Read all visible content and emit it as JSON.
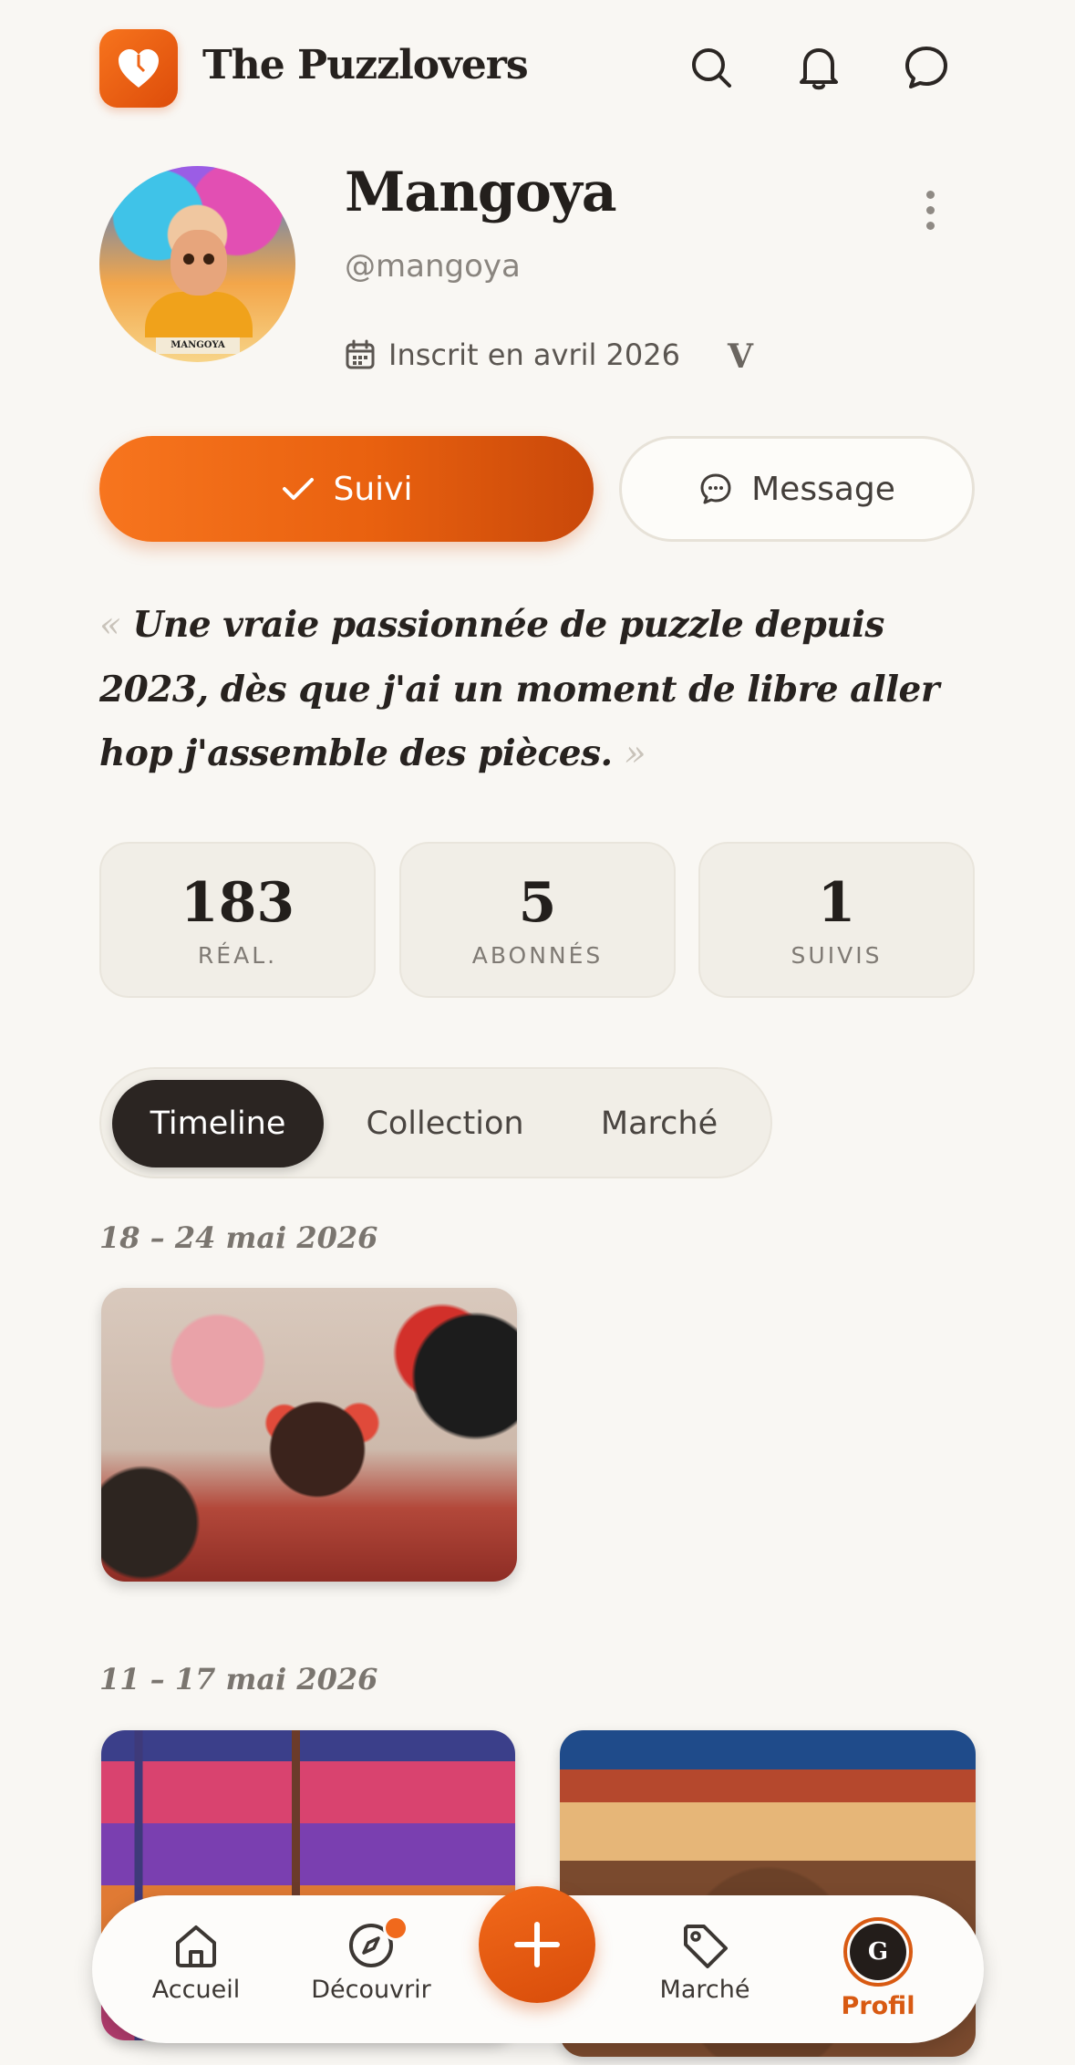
{
  "app": {
    "title": "The Puzzlovers",
    "accent_color": "#ef6416",
    "header_icons": [
      "search-icon",
      "bell-icon",
      "chat-icon"
    ]
  },
  "profile": {
    "name": "Mangoya",
    "handle": "@mangoya",
    "joined": "Inscrit en avril 2026",
    "badge": "V",
    "avatar_caption": "MANGOYA",
    "bio_open": "«",
    "bio": "Une vraie passionnée de puzzle depuis 2023, dès que j'ai un moment de libre aller hop j'assemble des pièces.",
    "bio_close": "»"
  },
  "actions": {
    "follow_label": "Suivi",
    "message_label": "Message"
  },
  "stats": [
    {
      "value": "183",
      "label": "RÉAL."
    },
    {
      "value": "5",
      "label": "ABONNÉS"
    },
    {
      "value": "1",
      "label": "SUIVIS"
    }
  ],
  "tabs": [
    {
      "label": "Timeline",
      "active": true
    },
    {
      "label": "Collection",
      "active": false
    },
    {
      "label": "Marché",
      "active": false
    }
  ],
  "timeline": [
    {
      "period": "18 – 24 mai 2026",
      "items": [
        "puzzle-portrait-red-glasses"
      ]
    },
    {
      "period": "11 – 17 mai 2026",
      "items": [
        "puzzle-bookshelf-cat",
        "puzzle-african-woman"
      ]
    }
  ],
  "bottom_nav": {
    "items": [
      {
        "label": "Accueil",
        "icon": "home-icon"
      },
      {
        "label": "Découvrir",
        "icon": "compass-icon"
      },
      {
        "label": "Marché",
        "icon": "tag-icon"
      },
      {
        "label": "Profil",
        "icon": "avatar",
        "initial": "G",
        "active": true
      }
    ],
    "fab_icon": "plus-icon"
  }
}
